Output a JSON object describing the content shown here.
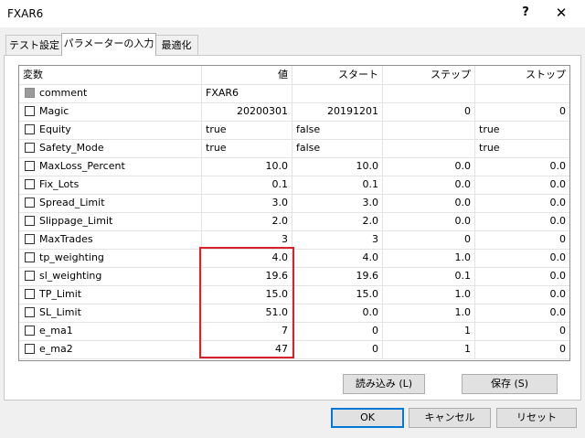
{
  "window": {
    "title": "FXAR6",
    "help_glyph": "?",
    "close_glyph": "✕"
  },
  "tabs": [
    {
      "label": "テスト設定"
    },
    {
      "label": "パラメーターの入力"
    },
    {
      "label": "最適化"
    }
  ],
  "table": {
    "headers": [
      "変数",
      "値",
      "スタート",
      "ステップ",
      "ストップ"
    ],
    "rows": [
      {
        "name": "comment",
        "value": "FXAR6",
        "start": "",
        "step": "",
        "stop": "",
        "checkbox": "disabled"
      },
      {
        "name": "Magic",
        "value": "20200301",
        "start": "20191201",
        "step": "0",
        "stop": "0",
        "checkbox": "unchecked"
      },
      {
        "name": "Equity",
        "value": "true",
        "start": "false",
        "step": "",
        "stop": "true",
        "checkbox": "unchecked"
      },
      {
        "name": "Safety_Mode",
        "value": "true",
        "start": "false",
        "step": "",
        "stop": "true",
        "checkbox": "unchecked"
      },
      {
        "name": "MaxLoss_Percent",
        "value": "10.0",
        "start": "10.0",
        "step": "0.0",
        "stop": "0.0",
        "checkbox": "unchecked"
      },
      {
        "name": "Fix_Lots",
        "value": "0.1",
        "start": "0.1",
        "step": "0.0",
        "stop": "0.0",
        "checkbox": "unchecked"
      },
      {
        "name": "Spread_Limit",
        "value": "3.0",
        "start": "3.0",
        "step": "0.0",
        "stop": "0.0",
        "checkbox": "unchecked"
      },
      {
        "name": "Slippage_Limit",
        "value": "2.0",
        "start": "2.0",
        "step": "0.0",
        "stop": "0.0",
        "checkbox": "unchecked"
      },
      {
        "name": "MaxTrades",
        "value": "3",
        "start": "3",
        "step": "0",
        "stop": "0",
        "checkbox": "unchecked"
      },
      {
        "name": "tp_weighting",
        "value": "4.0",
        "start": "4.0",
        "step": "1.0",
        "stop": "0.0",
        "checkbox": "unchecked"
      },
      {
        "name": "sl_weighting",
        "value": "19.6",
        "start": "19.6",
        "step": "0.1",
        "stop": "0.0",
        "checkbox": "unchecked"
      },
      {
        "name": "TP_Limit",
        "value": "15.0",
        "start": "15.0",
        "step": "1.0",
        "stop": "0.0",
        "checkbox": "unchecked"
      },
      {
        "name": "SL_Limit",
        "value": "51.0",
        "start": "0.0",
        "step": "1.0",
        "stop": "0.0",
        "checkbox": "unchecked"
      },
      {
        "name": "e_ma1",
        "value": "7",
        "start": "0",
        "step": "1",
        "stop": "0",
        "checkbox": "unchecked"
      },
      {
        "name": "e_ma2",
        "value": "47",
        "start": "0",
        "step": "1",
        "stop": "0",
        "checkbox": "unchecked"
      }
    ]
  },
  "buttons": {
    "load": "読み込み (L)",
    "save": "保存 (S)",
    "ok": "OK",
    "cancel": "キャンセル",
    "reset": "リセット"
  },
  "colors": {
    "highlight": "#d9232c",
    "ok_border": "#0078d7"
  }
}
